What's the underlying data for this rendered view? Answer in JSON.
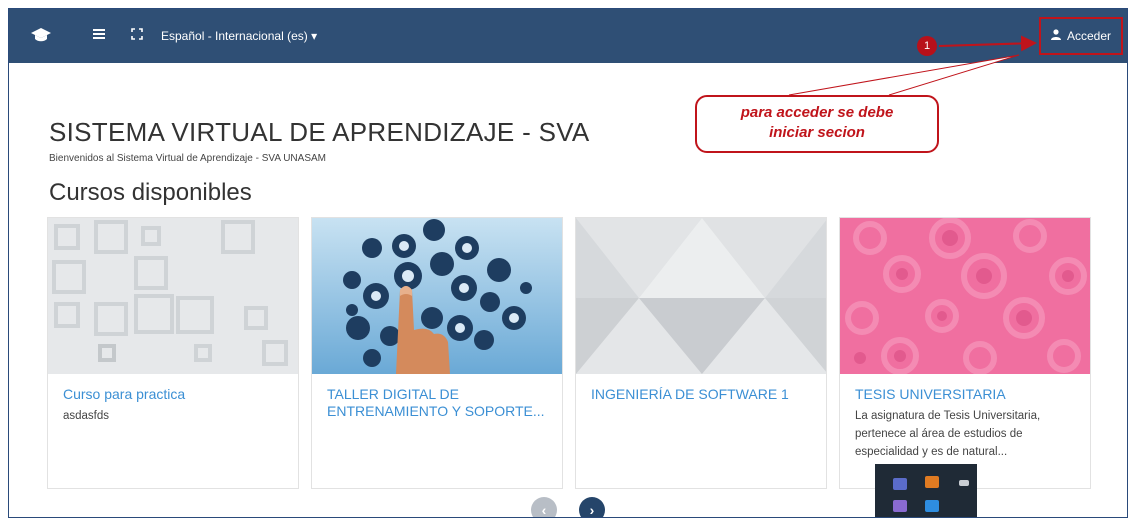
{
  "navbar": {
    "brand_icon": "graduation-cap-icon",
    "menu_icon": "hamburger-menu-icon",
    "fullscreen_icon": "expand-icon",
    "language_label": "Español - Internacional (es) ▾",
    "login_label": "Acceder",
    "login_icon": "user-icon"
  },
  "annotation": {
    "badge_number": "1",
    "callout_line1": "para acceder se debe",
    "callout_line2": "iniciar secion",
    "color": "#c0141b"
  },
  "site": {
    "title": "SISTEMA VIRTUAL DE APRENDIZAJE - SVA",
    "subtitle": "Bienvenidos al Sistema Virtual de Aprendizaje  - SVA UNASAM"
  },
  "section_title": "Cursos disponibles",
  "courses": [
    {
      "title": "Curso para practica",
      "summary": "asdasfds",
      "pattern": "gray-squares"
    },
    {
      "title": "TALLER DIGITAL DE ENTRENAMIENTO Y SOPORTE...",
      "summary": "",
      "pattern": "social-media-hand-photo"
    },
    {
      "title": "INGENIERÍA DE SOFTWARE 1",
      "summary": "",
      "pattern": "gray-triangles"
    },
    {
      "title": "TESIS UNIVERSITARIA",
      "summary": "La asignatura de Tesis Universitaria, pertenece al área de estudios de especialidad y es de natural...",
      "pattern": "pink-circles"
    }
  ],
  "pagination": {
    "prev_icon": "chevron-left-icon",
    "next_icon": "chevron-right-icon",
    "prev_glyph": "‹",
    "next_glyph": "›"
  },
  "colors": {
    "navbar": "#2f4f75",
    "link": "#3b8fd4",
    "pink": "#f06fa0"
  }
}
